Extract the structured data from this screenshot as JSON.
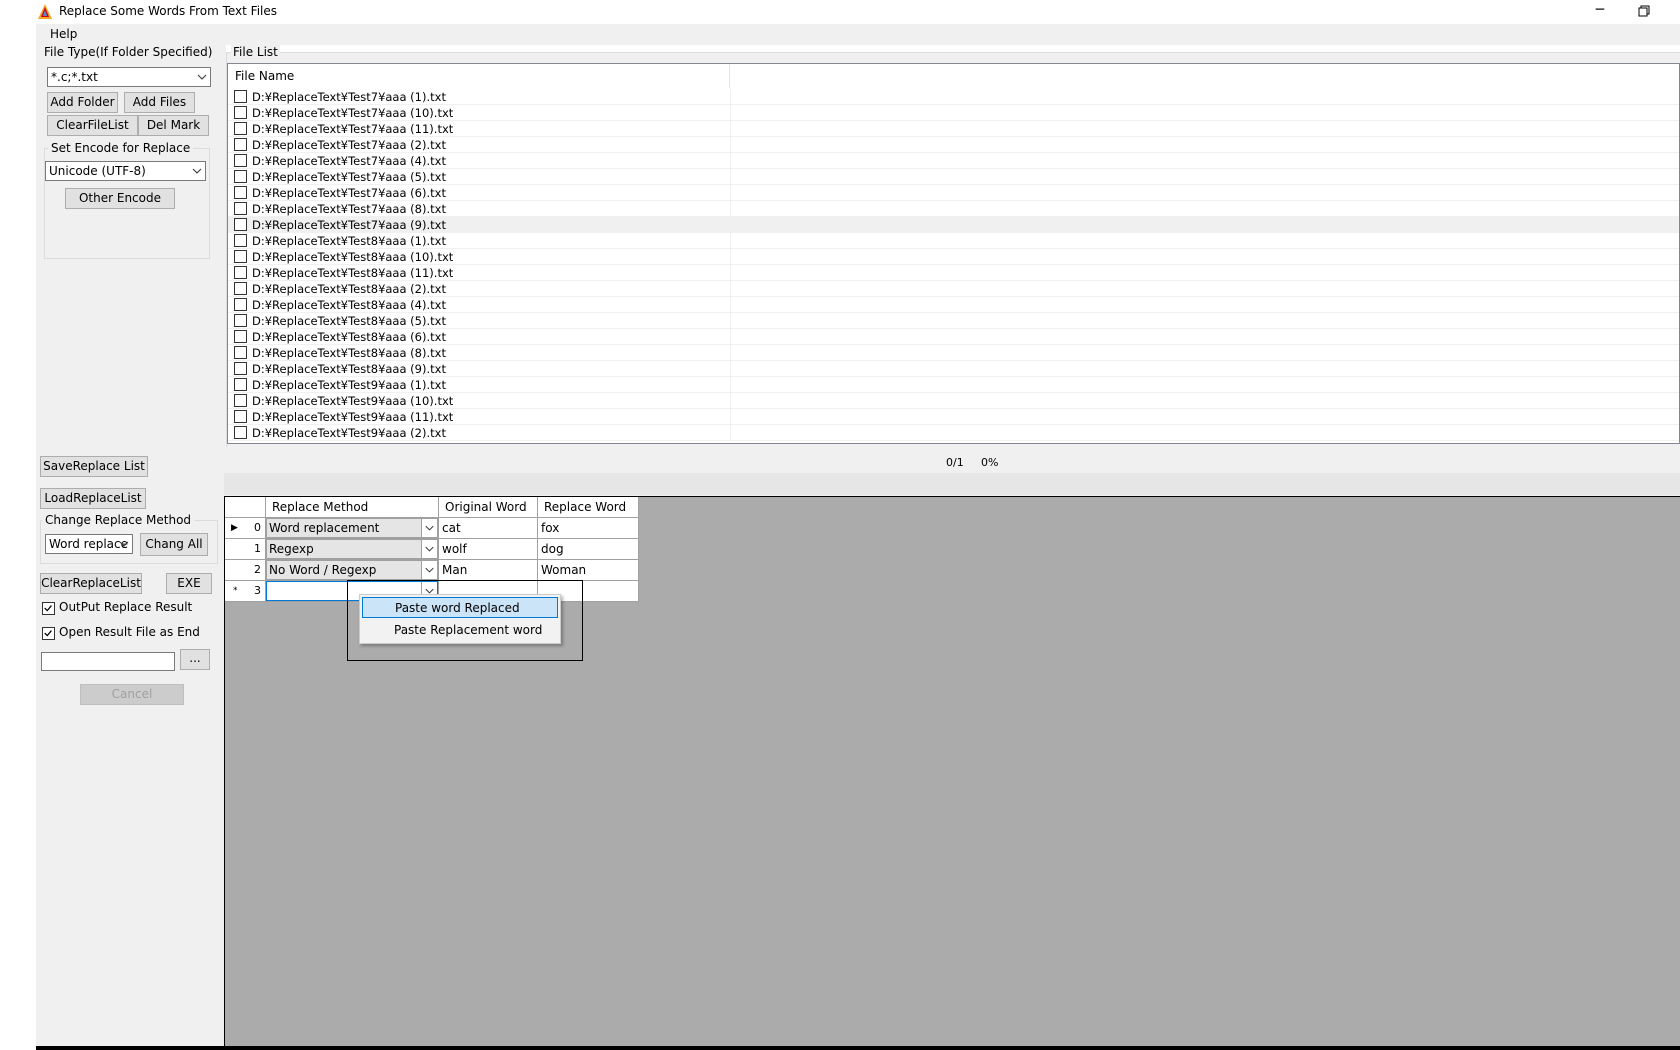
{
  "window": {
    "title": "Replace Some Words From Text Files",
    "minimize_glyph": "─"
  },
  "menu": {
    "help": "Help"
  },
  "left": {
    "file_type_label": "File Type(If Folder Specified)",
    "file_type_value": "*.c;*.txt",
    "add_folder": "Add Folder",
    "add_files": "Add Files",
    "clear_file_list": "ClearFileList",
    "del_mark": "Del Mark",
    "encode_label": "Set Encode for Replace",
    "encode_value": "Unicode (UTF-8)",
    "other_encode": "Other Encode",
    "save_replace_list": "SaveReplace List",
    "load_replace_list": "LoadReplaceList",
    "change_method_label": "Change Replace Method",
    "change_method_value": "Word replace",
    "chang_all": "Chang All",
    "clear_replace_list": "ClearReplaceList",
    "exe": "EXE",
    "output_result": "OutPut Replace Result",
    "open_result": "Open Result File as End",
    "browse": "...",
    "cancel": "Cancel",
    "output_result_checked": true,
    "open_result_checked": true
  },
  "file_list": {
    "label": "File List",
    "column": "File Name",
    "files": [
      "D:¥ReplaceText¥Test7¥aaa (1).txt",
      "D:¥ReplaceText¥Test7¥aaa (10).txt",
      "D:¥ReplaceText¥Test7¥aaa (11).txt",
      "D:¥ReplaceText¥Test7¥aaa (2).txt",
      "D:¥ReplaceText¥Test7¥aaa (4).txt",
      "D:¥ReplaceText¥Test7¥aaa (5).txt",
      "D:¥ReplaceText¥Test7¥aaa (6).txt",
      "D:¥ReplaceText¥Test7¥aaa (8).txt",
      "D:¥ReplaceText¥Test7¥aaa (9).txt",
      "D:¥ReplaceText¥Test8¥aaa (1).txt",
      "D:¥ReplaceText¥Test8¥aaa (10).txt",
      "D:¥ReplaceText¥Test8¥aaa (11).txt",
      "D:¥ReplaceText¥Test8¥aaa (2).txt",
      "D:¥ReplaceText¥Test8¥aaa (4).txt",
      "D:¥ReplaceText¥Test8¥aaa (5).txt",
      "D:¥ReplaceText¥Test8¥aaa (6).txt",
      "D:¥ReplaceText¥Test8¥aaa (8).txt",
      "D:¥ReplaceText¥Test8¥aaa (9).txt",
      "D:¥ReplaceText¥Test9¥aaa (1).txt",
      "D:¥ReplaceText¥Test9¥aaa (10).txt",
      "D:¥ReplaceText¥Test9¥aaa (11).txt",
      "D:¥ReplaceText¥Test9¥aaa (2).txt"
    ],
    "highlighted_index": 8
  },
  "progress": {
    "count": "0/1",
    "percent": "0%"
  },
  "grid": {
    "headers": [
      "Replace Method",
      "Original Word",
      "Replace Word"
    ],
    "rows": [
      {
        "index": "0",
        "method": "Word replacement",
        "original": "cat",
        "replace": "fox",
        "marker": "▶"
      },
      {
        "index": "1",
        "method": "Regexp",
        "original": "wolf",
        "replace": "dog",
        "marker": ""
      },
      {
        "index": "2",
        "method": "No Word / Regexp",
        "original": "Man",
        "replace": "Woman",
        "marker": ""
      },
      {
        "index": "3",
        "method": "",
        "original": "",
        "replace": "",
        "marker": "*"
      }
    ]
  },
  "context_menu": {
    "item1": "Paste word Replaced",
    "item2": "Paste Replacement word"
  },
  "colors": {
    "accent_border": "#0078d7",
    "highlight": "#cce4f7",
    "grid_bg": "#ababab",
    "panel_bg": "#f0f0f0"
  }
}
